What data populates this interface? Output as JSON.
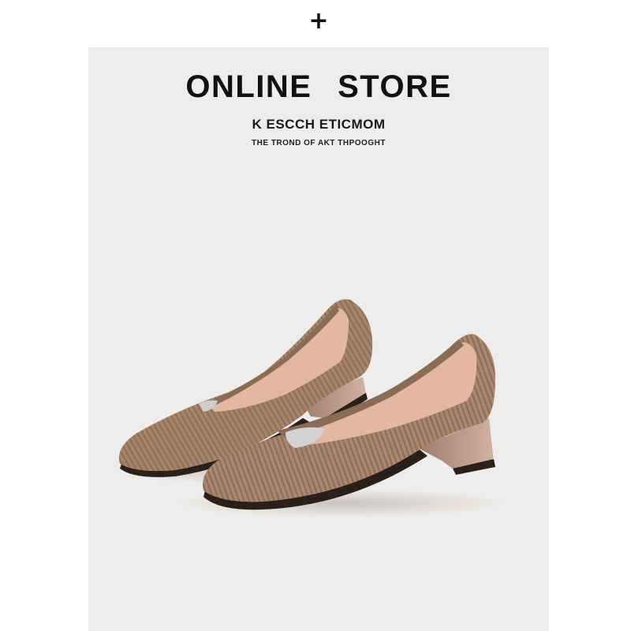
{
  "header": {
    "plus_symbol": "+"
  },
  "banner": {
    "title": "ONLINE STORE",
    "subtitle": "K ESCCH ETICMOM",
    "tagline": "THE TROND OF AKT THPOOGHT"
  },
  "colors": {
    "panel_background": "#efedeb",
    "knit_taupe": "#a7846c",
    "lining_pink": "#e3b8a2",
    "heel_block": "#bb9a8a",
    "sole_black": "#2b1f1a"
  },
  "icons": {
    "expand": "plus-icon"
  }
}
